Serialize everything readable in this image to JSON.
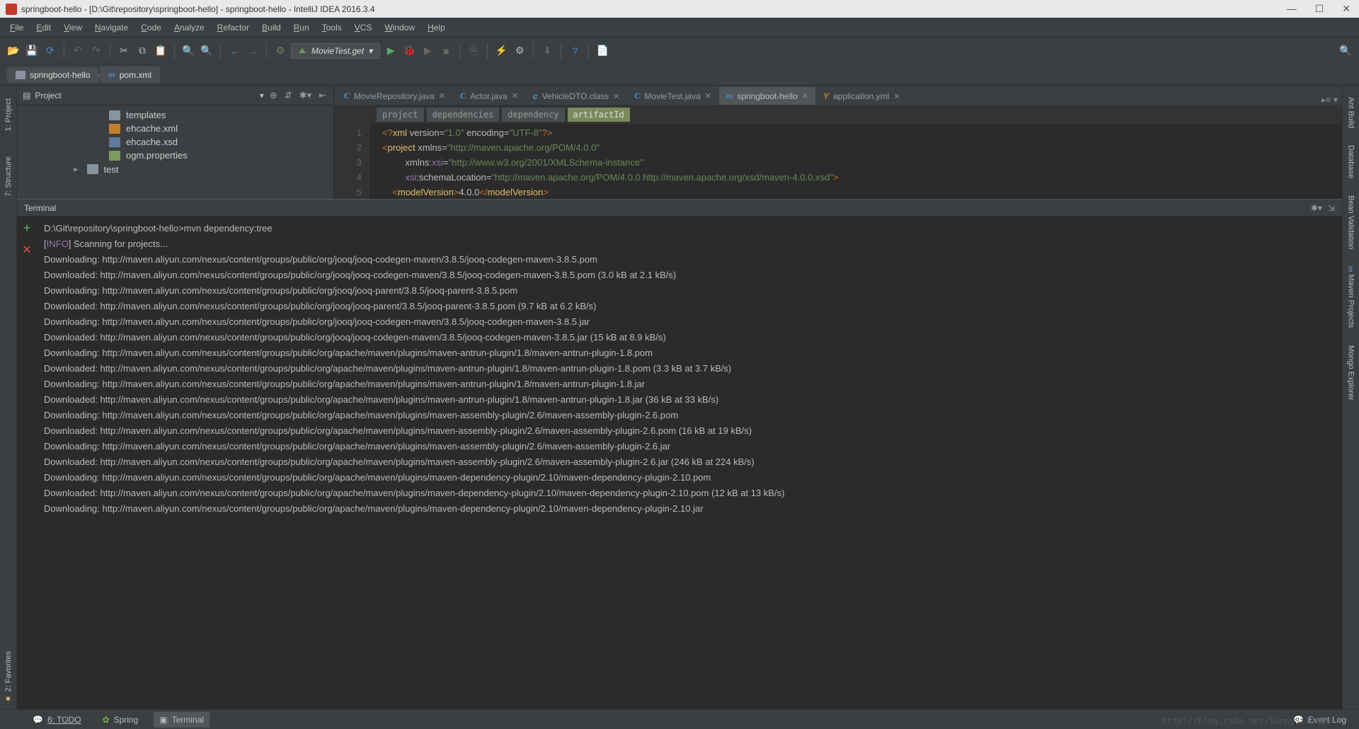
{
  "titlebar": {
    "text": "springboot-hello - [D:\\Git\\repository\\springboot-hello] - springboot-hello - IntelliJ IDEA 2016.3.4"
  },
  "menu": [
    "File",
    "Edit",
    "View",
    "Navigate",
    "Code",
    "Analyze",
    "Refactor",
    "Build",
    "Run",
    "Tools",
    "VCS",
    "Window",
    "Help"
  ],
  "run_config": "MovieTest.get",
  "breadcrumb": {
    "project": "springboot-hello",
    "file": "pom.xml"
  },
  "left_tools": [
    "1: Project",
    "7: Structure",
    "2: Favorites"
  ],
  "right_tools": [
    "Ant Build",
    "Database",
    "Bean Validation",
    "Maven Projects",
    "Mongo Explorer"
  ],
  "project_panel": {
    "title": "Project",
    "items": [
      {
        "name": "templates",
        "type": "folder",
        "indent": 1
      },
      {
        "name": "ehcache.xml",
        "type": "xml",
        "indent": 1
      },
      {
        "name": "ehcache.xsd",
        "type": "xsd",
        "indent": 1
      },
      {
        "name": "ogm.properties",
        "type": "prop",
        "indent": 1
      },
      {
        "name": "test",
        "type": "folder",
        "indent": 0,
        "arrow": true
      }
    ]
  },
  "tabs": [
    {
      "label": "MovieRepository.java",
      "icon": "java",
      "active": false
    },
    {
      "label": "Actor.java",
      "icon": "java",
      "active": false
    },
    {
      "label": "VehicleDTO.class",
      "icon": "class",
      "active": false
    },
    {
      "label": "MovieTest.java",
      "icon": "java",
      "active": false
    },
    {
      "label": "springboot-hello",
      "icon": "m",
      "active": true
    },
    {
      "label": "application.yml",
      "icon": "yml",
      "active": false
    }
  ],
  "crumb_tags": [
    "project",
    "dependencies",
    "dependency",
    "artifactId"
  ],
  "code_lines": [
    1,
    2,
    3,
    4,
    5
  ],
  "terminal": {
    "title": "Terminal",
    "lines": [
      "D:\\Git\\repository\\springboot-hello>mvn dependency:tree",
      {
        "prefix": "[",
        "info": "INFO",
        "suffix": "] Scanning for projects..."
      },
      "Downloading: http://maven.aliyun.com/nexus/content/groups/public/org/jooq/jooq-codegen-maven/3.8.5/jooq-codegen-maven-3.8.5.pom",
      "Downloaded: http://maven.aliyun.com/nexus/content/groups/public/org/jooq/jooq-codegen-maven/3.8.5/jooq-codegen-maven-3.8.5.pom (3.0 kB at 2.1 kB/s)",
      "Downloading: http://maven.aliyun.com/nexus/content/groups/public/org/jooq/jooq-parent/3.8.5/jooq-parent-3.8.5.pom",
      "Downloaded: http://maven.aliyun.com/nexus/content/groups/public/org/jooq/jooq-parent/3.8.5/jooq-parent-3.8.5.pom (9.7 kB at 6.2 kB/s)",
      "Downloading: http://maven.aliyun.com/nexus/content/groups/public/org/jooq/jooq-codegen-maven/3.8.5/jooq-codegen-maven-3.8.5.jar",
      "Downloaded: http://maven.aliyun.com/nexus/content/groups/public/org/jooq/jooq-codegen-maven/3.8.5/jooq-codegen-maven-3.8.5.jar (15 kB at 8.9 kB/s)",
      "Downloading: http://maven.aliyun.com/nexus/content/groups/public/org/apache/maven/plugins/maven-antrun-plugin/1.8/maven-antrun-plugin-1.8.pom",
      "Downloaded: http://maven.aliyun.com/nexus/content/groups/public/org/apache/maven/plugins/maven-antrun-plugin/1.8/maven-antrun-plugin-1.8.pom (3.3 kB at 3.7 kB/s)",
      "Downloading: http://maven.aliyun.com/nexus/content/groups/public/org/apache/maven/plugins/maven-antrun-plugin/1.8/maven-antrun-plugin-1.8.jar",
      "Downloaded: http://maven.aliyun.com/nexus/content/groups/public/org/apache/maven/plugins/maven-antrun-plugin/1.8/maven-antrun-plugin-1.8.jar (36 kB at 33 kB/s)",
      "Downloading: http://maven.aliyun.com/nexus/content/groups/public/org/apache/maven/plugins/maven-assembly-plugin/2.6/maven-assembly-plugin-2.6.pom",
      "Downloaded: http://maven.aliyun.com/nexus/content/groups/public/org/apache/maven/plugins/maven-assembly-plugin/2.6/maven-assembly-plugin-2.6.pom (16 kB at 19 kB/s)",
      "Downloading: http://maven.aliyun.com/nexus/content/groups/public/org/apache/maven/plugins/maven-assembly-plugin/2.6/maven-assembly-plugin-2.6.jar",
      "Downloaded: http://maven.aliyun.com/nexus/content/groups/public/org/apache/maven/plugins/maven-assembly-plugin/2.6/maven-assembly-plugin-2.6.jar (246 kB at 224 kB/s)",
      "Downloading: http://maven.aliyun.com/nexus/content/groups/public/org/apache/maven/plugins/maven-dependency-plugin/2.10/maven-dependency-plugin-2.10.pom",
      "Downloaded: http://maven.aliyun.com/nexus/content/groups/public/org/apache/maven/plugins/maven-dependency-plugin/2.10/maven-dependency-plugin-2.10.pom (12 kB at 13 kB/s)",
      "Downloading: http://maven.aliyun.com/nexus/content/groups/public/org/apache/maven/plugins/maven-dependency-plugin/2.10/maven-dependency-plugin-2.10.jar"
    ]
  },
  "bottom": {
    "todo": "6: TODO",
    "spring": "Spring",
    "terminal": "Terminal",
    "eventlog": "Event Log"
  },
  "watermark": "http://blog.csdn.net/SunnySilence"
}
